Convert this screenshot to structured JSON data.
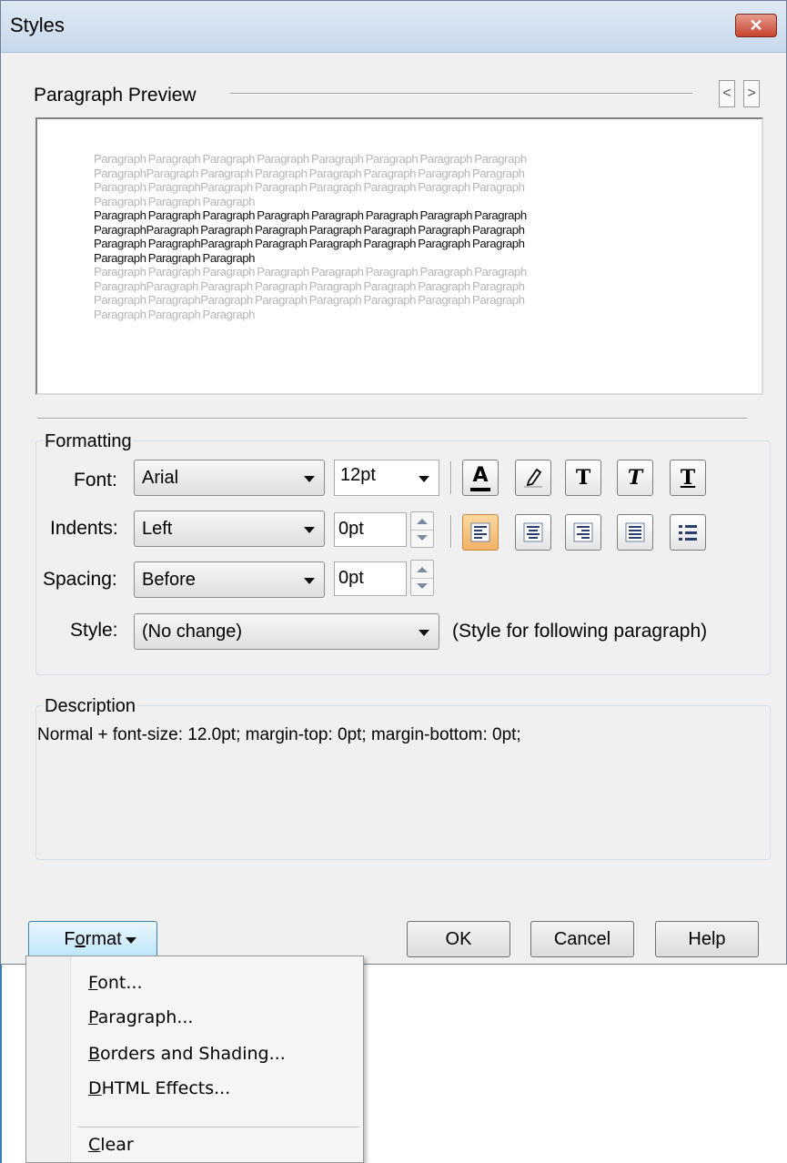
{
  "window": {
    "title": "Styles",
    "close_glyph": "✕"
  },
  "preview": {
    "heading": "Paragraph Preview",
    "nav_prev": "<",
    "nav_next": ">",
    "lines_before": [
      "Paragraph Paragraph Paragraph Paragraph Paragraph Paragraph Paragraph Paragraph",
      "ParagraphParagraph Paragraph Paragraph Paragraph Paragraph Paragraph Paragraph",
      "Paragraph ParagraphParagraph Paragraph Paragraph Paragraph Paragraph Paragraph",
      "Paragraph Paragraph Paragraph"
    ],
    "lines_current": [
      "Paragraph Paragraph Paragraph Paragraph Paragraph Paragraph Paragraph Paragraph",
      "ParagraphParagraph Paragraph Paragraph Paragraph Paragraph Paragraph Paragraph",
      "Paragraph ParagraphParagraph Paragraph Paragraph Paragraph Paragraph Paragraph",
      "Paragraph Paragraph Paragraph"
    ],
    "lines_after": [
      "Paragraph Paragraph Paragraph Paragraph Paragraph Paragraph Paragraph Paragraph",
      "ParagraphParagraph Paragraph Paragraph Paragraph Paragraph Paragraph Paragraph",
      "Paragraph ParagraphParagraph Paragraph Paragraph Paragraph Paragraph Paragraph",
      "Paragraph Paragraph Paragraph"
    ]
  },
  "formatting": {
    "heading": "Formatting",
    "font_label": "Font:",
    "font_value": "Arial",
    "size_value": "12pt",
    "indents_label": "Indents:",
    "indents_value": "Left",
    "indents_amount": "0pt",
    "spacing_label": "Spacing:",
    "spacing_value": "Before",
    "spacing_amount": "0pt",
    "style_label": "Style:",
    "style_value": "(No change)",
    "style_hint": "(Style for following paragraph)",
    "toolbar_icons": [
      "font-color-icon",
      "highlight-icon",
      "bold-icon",
      "italic-icon",
      "underline-icon"
    ],
    "align_icons": [
      "align-left-icon",
      "align-center-icon",
      "align-right-icon",
      "justify-icon",
      "bullet-list-icon"
    ],
    "active_align": "align-left",
    "active_color": "#f3b266"
  },
  "description": {
    "heading": "Description",
    "text": "Normal + font-size: 12.0pt;  margin-top: 0pt;  margin-bottom: 0pt;"
  },
  "buttons": {
    "format": "Format",
    "format_mnemonic": "o",
    "ok": "OK",
    "cancel": "Cancel",
    "help": "Help"
  },
  "format_menu": {
    "items": [
      {
        "label": "Font...",
        "mnemonic": "F"
      },
      {
        "label": "Paragraph...",
        "mnemonic": "P"
      },
      {
        "label": "Borders and Shading...",
        "mnemonic": "B"
      },
      {
        "label": "DHTML Effects...",
        "mnemonic": "D"
      },
      {
        "label": "Clear",
        "mnemonic": "C"
      }
    ]
  }
}
